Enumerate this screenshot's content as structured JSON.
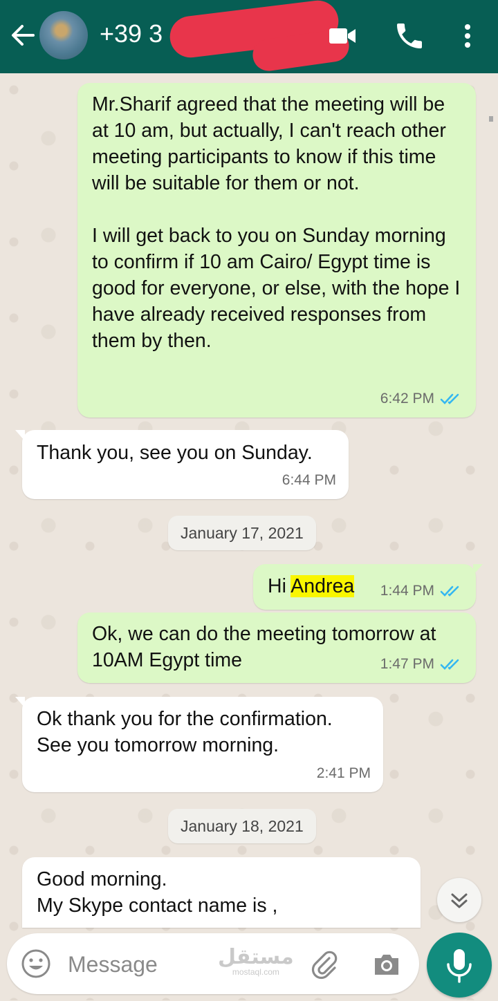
{
  "header": {
    "contact_name": "+39 3",
    "back_icon": "arrow-left-icon",
    "video_icon": "video-camera-icon",
    "call_icon": "phone-icon",
    "more_icon": "more-vertical-icon",
    "bg_color": "#075e54"
  },
  "messages": [
    {
      "direction": "out",
      "text": "Mr.Sharif agreed that the meeting will be at 10 am, but actually, I can't reach other meeting participants to know if this time will be suitable for them or not.\n\nI will get back to you on Sunday morning to confirm if 10 am Cairo/ Egypt time is good for everyone, or else, with the hope I have already received responses from them by then.",
      "time": "6:42 PM",
      "status": "read"
    },
    {
      "direction": "in",
      "text": "Thank you, see you on Sunday.",
      "time": "6:44 PM"
    },
    {
      "type": "date",
      "text": "January 17, 2021"
    },
    {
      "direction": "out",
      "prefix": "Hi ",
      "highlighted": "Andrea",
      "time": "1:44 PM",
      "status": "read"
    },
    {
      "direction": "out",
      "text": "Ok, we can do the meeting tomorrow at 10AM Egypt time",
      "time": "1:47 PM",
      "status": "read"
    },
    {
      "direction": "in",
      "text": "Ok thank you for the confirmation.\nSee you tomorrow morning.",
      "time": "2:41 PM"
    },
    {
      "type": "date",
      "text": "January 18, 2021"
    },
    {
      "direction": "in",
      "text": "Good morning.\nMy Skype contact name is ,"
    }
  ],
  "input": {
    "placeholder": "Message",
    "emoji_icon": "emoji-icon",
    "attach_icon": "paperclip-icon",
    "camera_icon": "camera-icon",
    "mic_icon": "microphone-icon"
  },
  "watermark": {
    "logo": "مستقل",
    "domain": "mostaql.com"
  },
  "colors": {
    "outgoing_bubble": "#dcf8c6",
    "incoming_bubble": "#ffffff",
    "read_ticks": "#34b7f1",
    "chat_background": "#ece5dd",
    "highlight": "#f9f600",
    "redaction": "#e8354b"
  }
}
